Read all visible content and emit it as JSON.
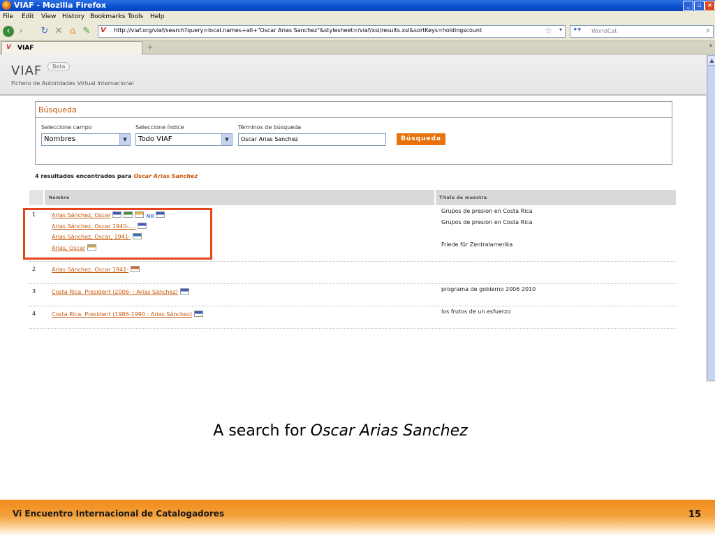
{
  "window": {
    "title": "VIAF - Mozilla Firefox"
  },
  "menu": [
    "File",
    "Edit",
    "View",
    "History",
    "Bookmarks",
    "Tools",
    "Help"
  ],
  "nav": {
    "url": "http://viaf.org/viaf/search?query=local.names+all+\"Oscar Arias Sanchez\"&stylesheet=/viaf/xsl/results.xsl&sortKeys=holdingscount",
    "search_placeholder": "WorldCat"
  },
  "tab": {
    "label": "VIAF"
  },
  "viaf": {
    "logo": "VIAF",
    "beta": "Beta",
    "subtitle": "Fichero de Autoridades Virtual Internacional"
  },
  "search": {
    "heading": "Búsqueda",
    "field_label": "Seleccione campo",
    "field_value": "Nombres",
    "index_label": "Seleccione índice",
    "index_value": "Todo VIAF",
    "terms_label": "Términos de búsqueda",
    "terms_value": "Oscar Arias Sanchez",
    "button": "Búsqueda"
  },
  "results_summary": {
    "text": "4 resultados encontrados para",
    "query": "Oscar Arias Sanchez"
  },
  "table_headers": {
    "name": "Nombre",
    "title": "Título de muestra"
  },
  "results": [
    {
      "num": "1",
      "names": [
        {
          "label": "Arias Sánchez, Oscar",
          "flags": [
            "#3b5bb5",
            "#3a8c3a",
            "#d9b54a",
            "NII",
            "#3b5bb5"
          ]
        },
        {
          "label": "Arias Sánchez, Oscar 1940-....",
          "flags": [
            "#3b5bb5"
          ]
        },
        {
          "label": "Arias Sánchez, Oscar, 1941-",
          "flags": [
            "#3a6fb0"
          ]
        },
        {
          "label": "Arias, Oscar",
          "flags": [
            "#c9a24a"
          ]
        }
      ],
      "titles": [
        "Grupos de presion en Costa Rica",
        "Grupos de presion en Costa Rica",
        "",
        "Friede für Zentralamerika"
      ]
    },
    {
      "num": "2",
      "names": [
        {
          "label": "Arias Sánchez, Oscar 1941-",
          "flags": [
            "#d2693c"
          ]
        }
      ],
      "titles": []
    },
    {
      "num": "3",
      "names": [
        {
          "label": "Costa Rica. President (2006- : Arias Sánchez)",
          "flags": [
            "#3b5bb5"
          ]
        }
      ],
      "titles": [
        "programa de gobierno 2006 2010"
      ]
    },
    {
      "num": "4",
      "names": [
        {
          "label": "Costa Rica. President (1986-1990 : Arias Sánchez)",
          "flags": [
            "#3b5bb5"
          ]
        }
      ],
      "titles": [
        "los frutos de un esfuerzo"
      ]
    }
  ],
  "slide": {
    "caption_prefix": "A search for",
    "caption_query": "Oscar Arias Sanchez",
    "footer": "Vi Encuentro Internacional de Catalogadores",
    "page": "15"
  }
}
